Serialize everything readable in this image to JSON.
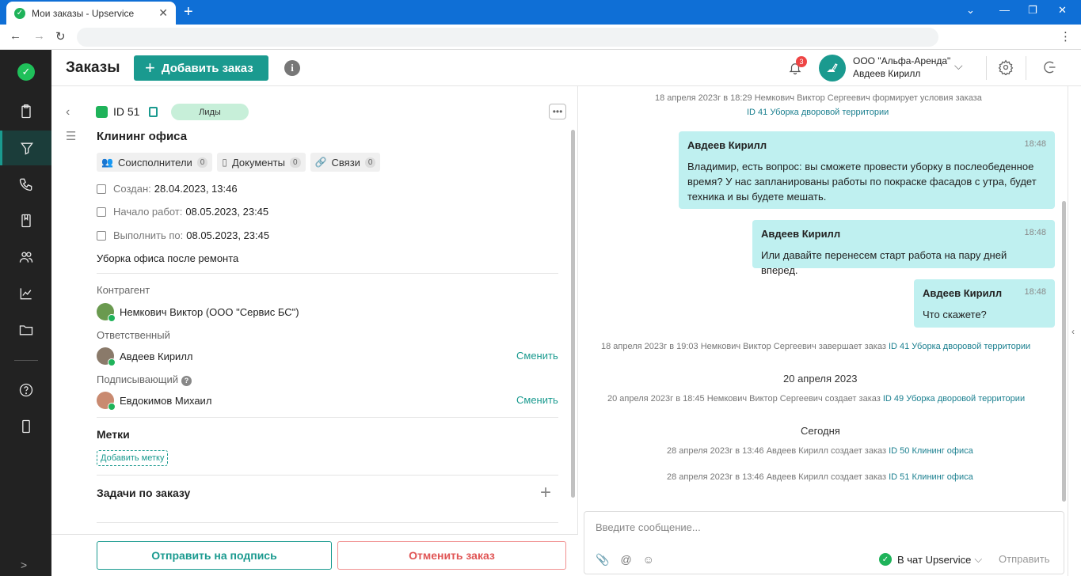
{
  "browser": {
    "tab_title": "Мои заказы - Upservice",
    "tab_close": "✕",
    "new_tab": "+"
  },
  "header": {
    "title": "Заказы",
    "add_order": "Добавить заказ",
    "notifications_count": "3",
    "company": "ООО \"Альфа-Аренда\"",
    "user": "Авдеев Кирилл"
  },
  "order": {
    "id": "ID 51",
    "status": "Лиды",
    "title": "Клининг офиса",
    "chips": [
      {
        "label": "Соисполнители",
        "count": "0"
      },
      {
        "label": "Документы",
        "count": "0"
      },
      {
        "label": "Связи",
        "count": "0"
      }
    ],
    "created_label": "Создан:",
    "created_value": "28.04.2023, 13:46",
    "start_label": "Начало работ:",
    "start_value": "08.05.2023, 23:45",
    "due_label": "Выполнить по:",
    "due_value": "08.05.2023, 23:45",
    "description": "Уборка офиса после ремонта",
    "contractor_label": "Контрагент",
    "contractor": "Немкович Виктор (ООО \"Сервис БС\")",
    "responsible_label": "Ответственный",
    "responsible": "Авдеев Кирилл",
    "signer_label": "Подписывающий",
    "signer": "Евдокимов Михаил",
    "change": "Сменить",
    "tags_title": "Метки",
    "add_tag": "Добавить метку",
    "tasks_title": "Задачи по заказу",
    "send_sign": "Отправить на подпись",
    "cancel_order": "Отменить заказ"
  },
  "chat": {
    "sys1_text": "18 апреля 2023г в 18:29 Немкович Виктор Сергеевич формирует условия заказа",
    "sys1_link": "ID 41 Уборка дворовой территории",
    "messages": [
      {
        "author": "Авдеев Кирилл",
        "time": "18:48",
        "text": "Владимир, есть вопрос: вы сможете провести уборку в послеобеденное время? У нас запланированы работы по покраске фасадов с утра, будет техника и вы будете мешать."
      },
      {
        "author": "Авдеев Кирилл",
        "time": "18:48",
        "text": "Или давайте перенесем старт работа на пару дней вперед."
      },
      {
        "author": "Авдеев Кирилл",
        "time": "18:48",
        "text": "Что скажете?"
      }
    ],
    "sys2_text": "18 апреля 2023г в 19:03 Немкович Виктор Сергеевич завершает заказ",
    "sys2_link": "ID 41 Уборка дворовой территории",
    "day1": "20 апреля 2023",
    "sys3_text": "20 апреля 2023г в 18:45 Немкович Виктор Сергеевич создает заказ",
    "sys3_link": "ID 49 Уборка дворовой территории",
    "day2": "Сегодня",
    "sys4_text": "28 апреля 2023г в 13:46 Авдеев Кирилл создает заказ",
    "sys4_link": "ID 50 Клининг офиса",
    "sys5_text": "28 апреля 2023г в 13:46 Авдеев Кирилл создает заказ",
    "sys5_link": "ID 51 Клининг офиса",
    "placeholder": "Введите сообщение...",
    "target": "В чат Upservice",
    "send": "Отправить"
  },
  "colors": {
    "accent": "#1a9a8f",
    "nav_bg": "#222222",
    "bubble": "#bff0f0",
    "danger": "#e05555"
  }
}
